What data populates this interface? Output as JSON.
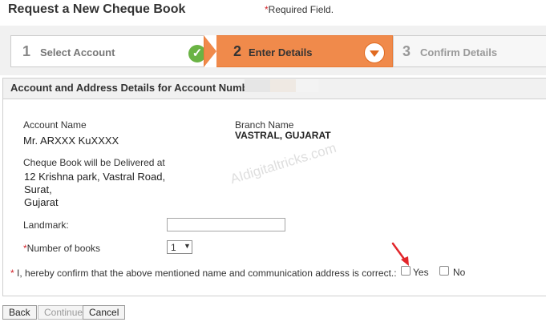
{
  "header": {
    "title": "Request a New Cheque Book",
    "required_star": "*",
    "required_note": "Required Field."
  },
  "steps": [
    {
      "number": "1",
      "label": "Select Account",
      "status": "complete"
    },
    {
      "number": "2",
      "label": "Enter Details",
      "status": "active"
    },
    {
      "number": "3",
      "label": "Confirm Details",
      "status": "pending"
    }
  ],
  "section": {
    "title": "Account and Address Details for Account Number:"
  },
  "form": {
    "account_name_label": "Account Name",
    "account_name": "Mr. ARXXX KuXXXX",
    "branch_name_label": "Branch Name",
    "branch_name": "VASTRAL, GUJARAT",
    "delivery_label": "Cheque Book will be Delivered at",
    "address_lines": [
      "12 Krishna park, Vastral Road,",
      "Surat,",
      "Gujarat"
    ],
    "landmark_label": "Landmark:",
    "landmark_value": "",
    "books_label": "Number of books",
    "books_value": "1",
    "confirm_text": "I, hereby confirm that the above mentioned name and communication address is correct.:",
    "yes_label": "Yes",
    "no_label": "No"
  },
  "watermark": "AIdigitaltricks.com",
  "buttons": {
    "back": "Back",
    "continue": "Continue",
    "cancel": "Cancel"
  },
  "colors": {
    "active_step": "#f08a4b",
    "complete_check": "#6ab344",
    "required": "#d2232a",
    "arrow": "#e2262b"
  },
  "icons": {
    "step1": "check-icon",
    "step2": "chevron-down-icon",
    "annotation": "arrow-icon"
  }
}
